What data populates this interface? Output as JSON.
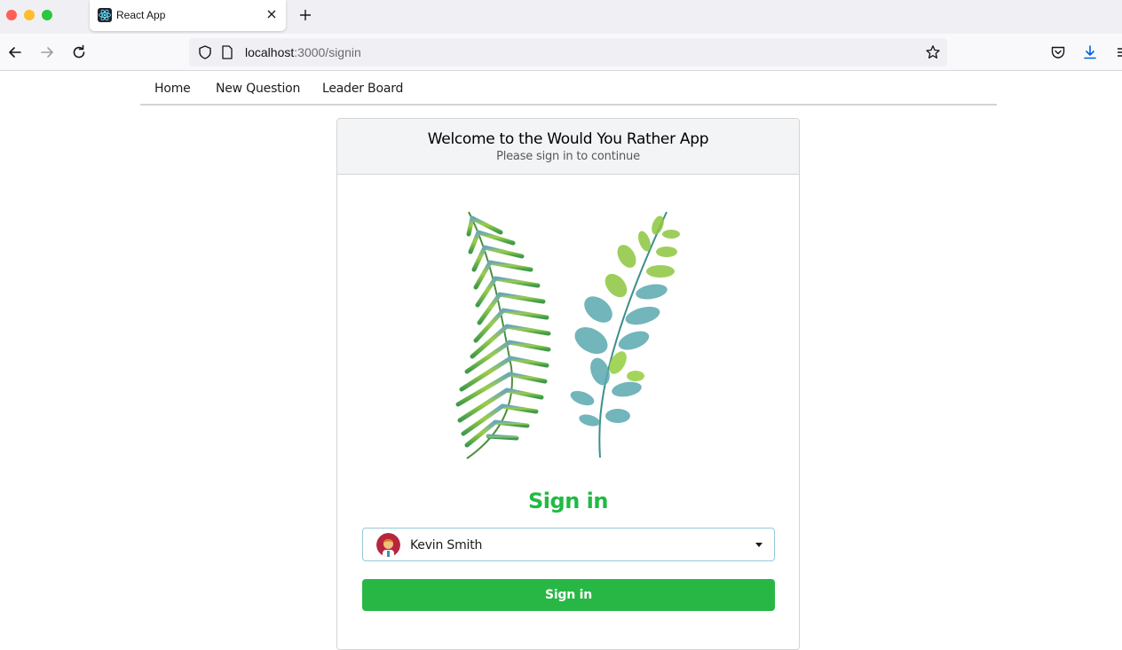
{
  "browser": {
    "tab_title": "React App",
    "url_host": "localhost",
    "url_rest": ":3000/signin"
  },
  "app_nav": {
    "items": [
      {
        "label": "Home"
      },
      {
        "label": "New Question"
      },
      {
        "label": "Leader Board"
      }
    ]
  },
  "card": {
    "title": "Welcome to the Would You Rather App",
    "subtitle": "Please sign in to continue",
    "signin_heading": "Sign in",
    "selected_user": "Kevin Smith",
    "button_label": "Sign in"
  },
  "colors": {
    "accent": "#21ba45",
    "button": "#28b745",
    "select_border": "#96c8da"
  },
  "icons": [
    "react-favicon",
    "close-icon",
    "plus-icon",
    "back-arrow-icon",
    "forward-arrow-icon",
    "reload-icon",
    "shield-icon",
    "page-icon",
    "star-icon",
    "pocket-icon",
    "download-icon",
    "menu-icon",
    "avatar",
    "chevron-down-icon"
  ]
}
